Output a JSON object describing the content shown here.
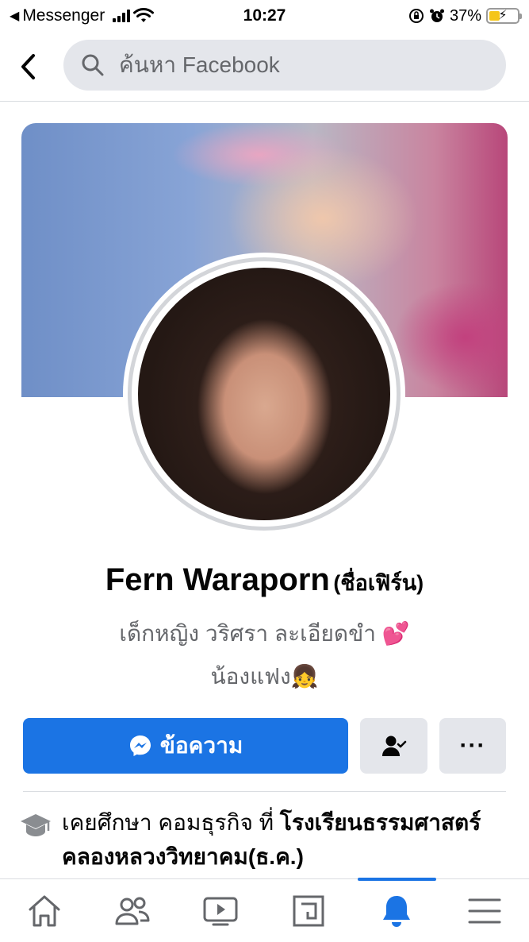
{
  "status_bar": {
    "back_app": "Messenger",
    "time": "10:27",
    "battery_percent": "37%",
    "battery_level": 0.37,
    "icons": [
      "back-arrow-icon",
      "signal-icon",
      "wifi-icon",
      "orientation-lock-icon",
      "alarm-icon",
      "battery-charging-icon"
    ]
  },
  "header": {
    "back_icon": "chevron-left-icon",
    "search_icon": "search-icon",
    "search_placeholder": "ค้นหา Facebook"
  },
  "profile": {
    "name": "Fern Waraporn",
    "nickname": "(ชื่อเฟิร์น)",
    "bio_line1": "เด็กหญิง วริศรา ละเอียดขำ 💕",
    "bio_line2": "น้องแฟง👧"
  },
  "actions": {
    "message_label": "ข้อความ",
    "message_icon": "messenger-icon",
    "friends_icon": "friend-check-icon",
    "more_label": "···",
    "accent": "#1b74e4"
  },
  "education": {
    "icon": "graduation-cap-icon",
    "prefix": "เคยศึกษา คอมธุรกิจ ที่ ",
    "school": "โรงเรียนธรรมศาสตร์คลองหลวงวิทยาคม(ธ.ค.)"
  },
  "tabbar": {
    "active_index": 4,
    "tabs": [
      "home-icon",
      "friends-icon",
      "watch-icon",
      "marketplace-icon",
      "notifications-bell-icon",
      "menu-icon"
    ]
  }
}
